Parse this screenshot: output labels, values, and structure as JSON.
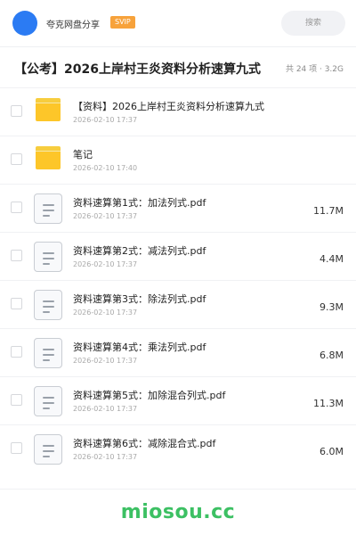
{
  "app": {
    "name": "夸克网盘分享",
    "badge": "SVIP",
    "search_label": "搜索"
  },
  "share": {
    "title": "【公考】2026上岸村王炎资料分析速算九式",
    "meta": "共 24 项 · 3.2G"
  },
  "files": [
    {
      "type": "folder",
      "name": "【资料】2026上岸村王炎资料分析速算九式",
      "date": "2026-02-10 17:37",
      "size": ""
    },
    {
      "type": "folder",
      "name": "笔记",
      "date": "2026-02-10 17:40",
      "size": ""
    },
    {
      "type": "file",
      "name": "资料速算第1式：加法列式.pdf",
      "date": "2026-02-10 17:37",
      "size": "11.7M"
    },
    {
      "type": "file",
      "name": "资料速算第2式：减法列式.pdf",
      "date": "2026-02-10 17:37",
      "size": "4.4M"
    },
    {
      "type": "file",
      "name": "资料速算第3式：除法列式.pdf",
      "date": "2026-02-10 17:37",
      "size": "9.3M"
    },
    {
      "type": "file",
      "name": "资料速算第4式：乘法列式.pdf",
      "date": "2026-02-10 17:37",
      "size": "6.8M"
    },
    {
      "type": "file",
      "name": "资料速算第5式：加除混合列式.pdf",
      "date": "2026-02-10 17:37",
      "size": "11.3M"
    },
    {
      "type": "file",
      "name": "资料速算第6式：减除混合式.pdf",
      "date": "2026-02-10 17:37",
      "size": "6.0M"
    }
  ],
  "icons": {
    "folder": "folder-icon",
    "file": "document-icon"
  },
  "colors": {
    "avatar": "#2b7bf3",
    "svip_badge": "#f7a23b",
    "folder": "#fdc629",
    "watermark": "#3cc063"
  },
  "watermark": "miosou.cc"
}
